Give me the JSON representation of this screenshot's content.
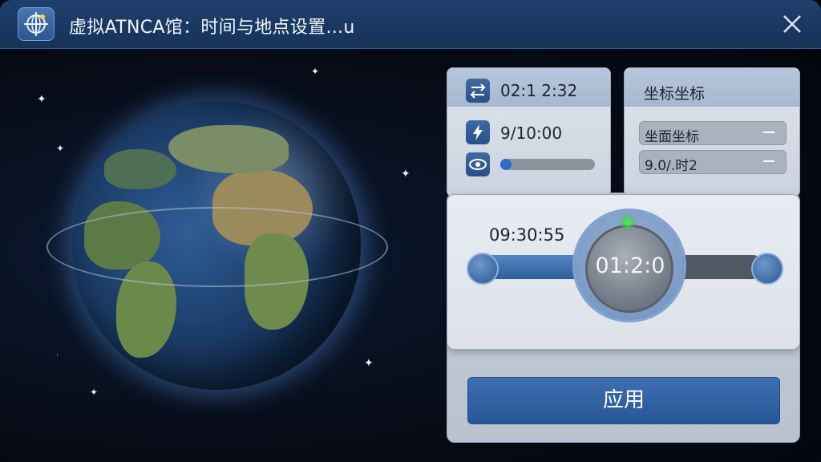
{
  "window": {
    "title": "虚拟ATNCA馆：时间与地点设置...u"
  },
  "time_panel": {
    "header_value": "02:1 2:32",
    "lightning_value": "9/10:00",
    "visibility_progress": 0.08
  },
  "coord_panel": {
    "header_label": "坐标坐标",
    "field1_value": "坐面坐标",
    "field2_value": "9.0/.时2"
  },
  "slider_panel": {
    "left_time": "09:30:55",
    "dial_time": "01:2:0",
    "slider_fill_fraction": 0.42
  },
  "apply_button": {
    "label": "应用"
  },
  "colors": {
    "accent": "#2f5e9c",
    "titlebar": "#1f3f6e",
    "led": "#47e05a"
  },
  "icons": [
    "globe-crosshair-icon",
    "close-icon",
    "swap-arrows-icon",
    "lightning-icon",
    "eye-icon",
    "minus-icon"
  ]
}
